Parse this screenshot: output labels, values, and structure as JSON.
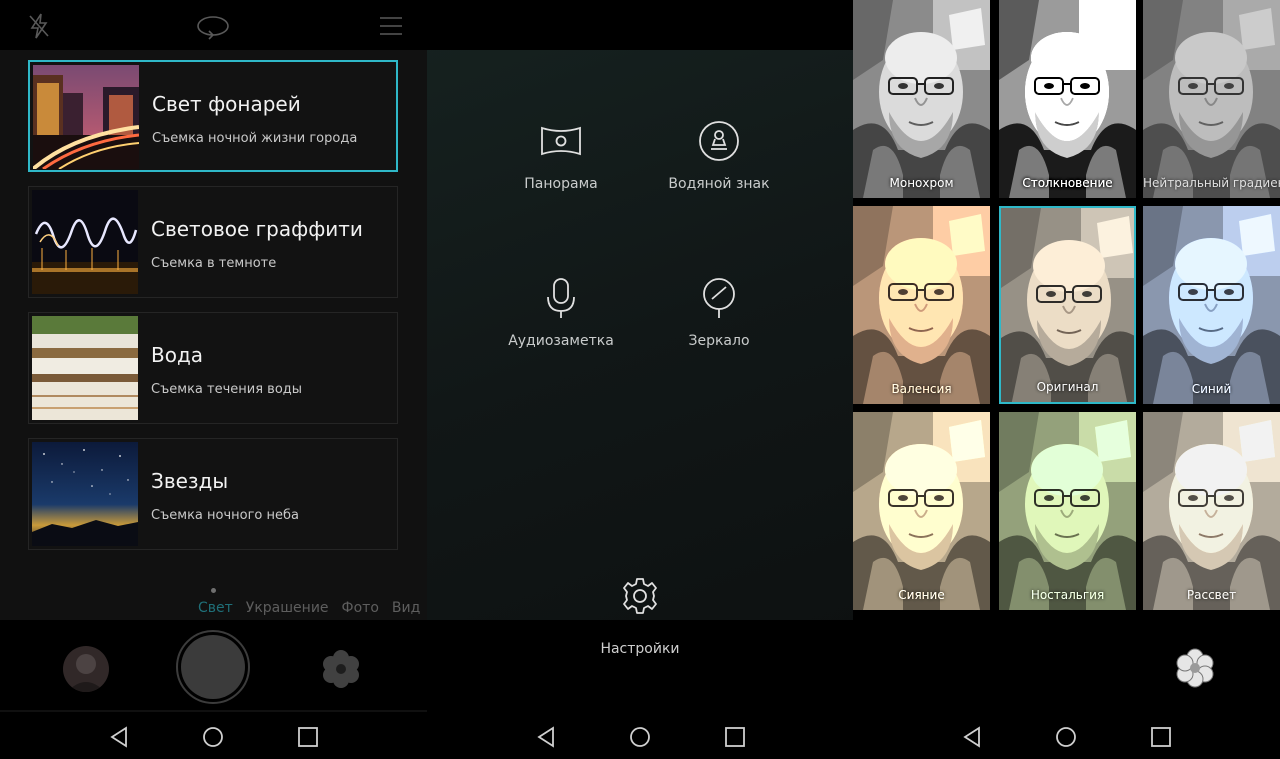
{
  "camera_modes": {
    "items": [
      {
        "title": "Свет фонарей",
        "subtitle": "Съемка ночной жизни города",
        "selected": true
      },
      {
        "title": "Световое граффити",
        "subtitle": "Съемка в темноте",
        "selected": false
      },
      {
        "title": "Вода",
        "subtitle": "Съемка течения воды",
        "selected": false
      },
      {
        "title": "Звезды",
        "subtitle": "Съемка ночного неба",
        "selected": false
      }
    ],
    "tabs": [
      {
        "label": "Свет",
        "active": true
      },
      {
        "label": "Украшение",
        "active": false
      },
      {
        "label": "Фото",
        "active": false
      },
      {
        "label": "Вид",
        "active": false
      }
    ],
    "top_icons": [
      "flash-off-icon",
      "switch-camera-icon",
      "menu-icon"
    ]
  },
  "tools_menu": {
    "items": [
      {
        "label": "Панорама",
        "icon": "panorama-icon"
      },
      {
        "label": "Водяной знак",
        "icon": "watermark-icon"
      },
      {
        "label": "Аудиозаметка",
        "icon": "microphone-icon"
      },
      {
        "label": "Зеркало",
        "icon": "mirror-icon"
      }
    ],
    "settings_label": "Настройки"
  },
  "filters": {
    "items": [
      {
        "label": "Монохром",
        "selected": false
      },
      {
        "label": "Столкновение",
        "selected": false
      },
      {
        "label": "Нейтральный градиент",
        "selected": false
      },
      {
        "label": "Валенсия",
        "selected": false
      },
      {
        "label": "Оригинал",
        "selected": true
      },
      {
        "label": "Синий",
        "selected": false
      },
      {
        "label": "Сияние",
        "selected": false
      },
      {
        "label": "Ностальгия",
        "selected": false
      },
      {
        "label": "Рассвет",
        "selected": false
      }
    ]
  },
  "colors": {
    "accent": "#2fb8c8",
    "active_tab": "#1f6f78",
    "background": "#000000"
  },
  "nav_icons": [
    "back-icon",
    "home-icon",
    "recents-icon"
  ]
}
